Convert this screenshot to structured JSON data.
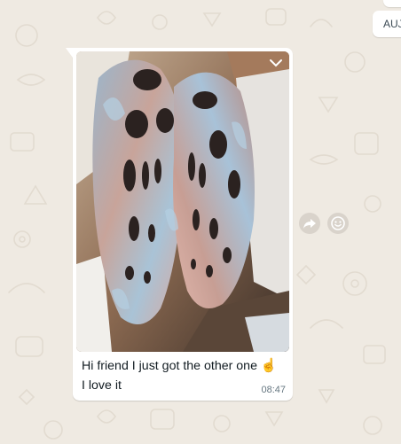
{
  "date_chip": {
    "text": "AUJ"
  },
  "message": {
    "caption_line1": "Hi friend I just got the other one",
    "caption_emoji": "☝️",
    "caption_line2": "I love it",
    "time": "08:47",
    "photo_subject": "shoes-photo"
  },
  "icons": {
    "menu": "chevron-down-icon",
    "forward": "forward-icon",
    "react": "emoji-icon"
  },
  "colors": {
    "wallpaper": "#efeae2",
    "bubble": "#ffffff",
    "text": "#111b21",
    "meta": "#667781",
    "button": "#d9d3cb"
  }
}
